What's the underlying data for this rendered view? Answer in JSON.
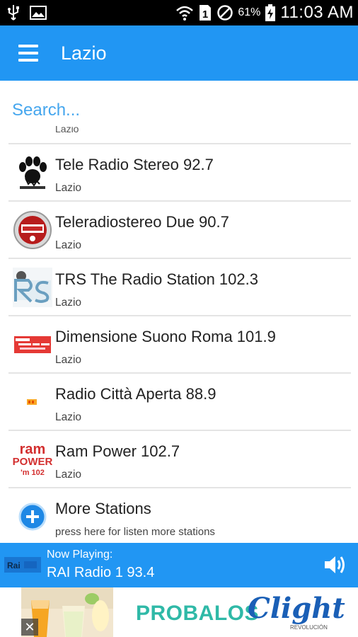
{
  "status_bar": {
    "battery_percent": "61%",
    "sim_slot": "1",
    "time": "11:03 AM"
  },
  "app_bar": {
    "title": "Lazio"
  },
  "search": {
    "placeholder": "Search...",
    "partial_region_above": "Lazio"
  },
  "stations": [
    {
      "name": "Tele Radio Stereo 92.7",
      "region": "Lazio",
      "logo": "paw-logo"
    },
    {
      "name": "Teleradiostereo Due 90.7",
      "region": "Lazio",
      "logo": "round-red-logo"
    },
    {
      "name": "TRS The Radio Station 102.3",
      "region": "Lazio",
      "logo": "trs-logo"
    },
    {
      "name": "Dimensione Suono Roma 101.9",
      "region": "Lazio",
      "logo": "dimensione-suono-logo"
    },
    {
      "name": "Radio Città Aperta 88.9",
      "region": "Lazio",
      "logo": "radio-citta-aperta-logo"
    },
    {
      "name": "Ram Power 102.7",
      "region": "Lazio",
      "logo": "ram-power-logo"
    }
  ],
  "more_stations": {
    "title": "More Stations",
    "subtitle": "press here for listen more stations",
    "icon": "plus-circle-icon"
  },
  "now_playing": {
    "label": "Now Playing:",
    "station": "RAI Radio 1 93.4",
    "thumb_text": "Rai"
  },
  "ad": {
    "headline": "PROBALOS",
    "brand": "Clight",
    "brand_sub": "REVOLUCIÓN",
    "close_label": "✕"
  },
  "colors": {
    "primary": "#2196f3",
    "status_bar": "#000000",
    "ad_headline": "#2fb9a7",
    "ad_brand": "#1a5fb6"
  }
}
